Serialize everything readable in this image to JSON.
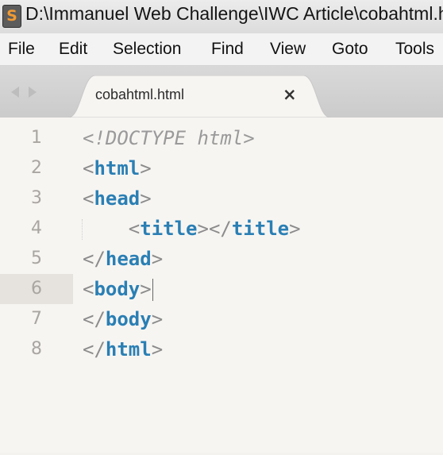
{
  "window": {
    "title": "D:\\Immanuel Web Challenge\\IWC Article\\cobahtml.html - Sublime Text",
    "app_icon": "sublime-text-icon",
    "app_icon_glyph": "S"
  },
  "menu": {
    "items": [
      "File",
      "Edit",
      "Selection",
      "Find",
      "View",
      "Goto",
      "Tools"
    ]
  },
  "tab": {
    "label": "cobahtml.html",
    "close_glyph": "×"
  },
  "editor": {
    "current_line": 6,
    "lines": [
      {
        "num": "1",
        "open": "<",
        "tag": "!DOCTYPE html",
        "close": ">",
        "kind": "doctype"
      },
      {
        "num": "2",
        "open": "<",
        "tag": "html",
        "close": ">"
      },
      {
        "num": "3",
        "open": "<",
        "tag": "head",
        "close": ">"
      },
      {
        "num": "4",
        "indent": "    ",
        "open": "<",
        "tag": "title",
        "close": ">",
        "open2": "</",
        "tag2": "title",
        "close2": ">"
      },
      {
        "num": "5",
        "open": "</",
        "tag": "head",
        "close": ">"
      },
      {
        "num": "6",
        "open": "<",
        "tag": "body",
        "close": ">"
      },
      {
        "num": "7",
        "open": "</",
        "tag": "body",
        "close": ">"
      },
      {
        "num": "8",
        "open": "</",
        "tag": "html",
        "close": ">"
      }
    ]
  },
  "colors": {
    "tag_keyword": "#2a7fb4",
    "punctuation": "#8c8c8c",
    "doctype": "#9a9a9a",
    "editor_background": "#f7f5f2"
  }
}
